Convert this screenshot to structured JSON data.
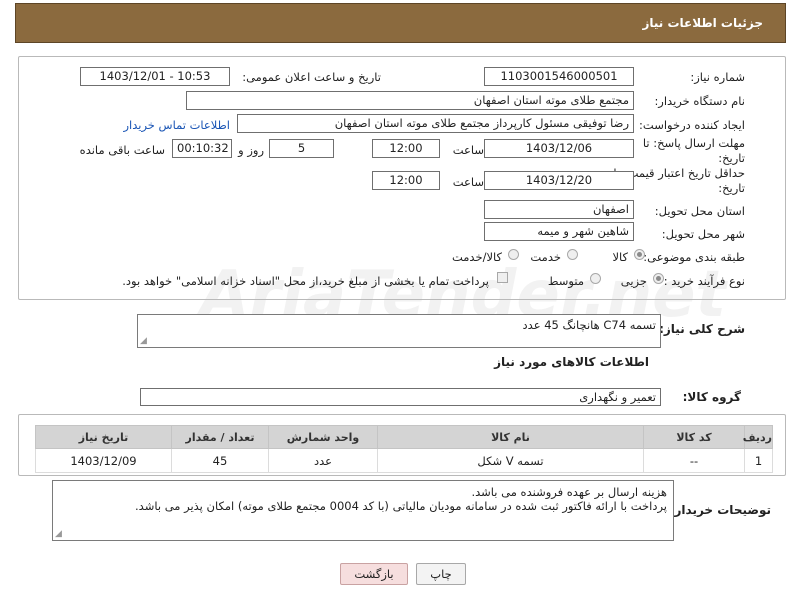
{
  "header": {
    "title": "جزئیات اطلاعات نیاز"
  },
  "watermark": {
    "text": "AriaTender.net"
  },
  "form": {
    "need_number_label": "شماره نیاز:",
    "need_number": "1103001546000501",
    "announce_label": "تاریخ و ساعت اعلان عمومی:",
    "announce_value": "1403/12/01 - 10:53",
    "buyer_org_label": "نام دستگاه خریدار:",
    "buyer_org": "مجتمع طلای موته استان اصفهان",
    "creator_label": "ایجاد کننده درخواست:",
    "creator": "رضا توفیقی مسئول کارپرداز مجتمع طلای موته استان اصفهان",
    "contact_link": "اطلاعات تماس خریدار",
    "reply_deadline_label_1": "مهلت ارسال پاسخ: تا",
    "reply_deadline_label_2": "تاریخ:",
    "reply_date": "1403/12/06",
    "time_label": "ساعت",
    "reply_time": "12:00",
    "days_value": "5",
    "days_label": "روز و",
    "remaining_value": "00:10:32",
    "remaining_label": "ساعت باقی مانده",
    "price_validity_label_1": "حداقل تاریخ اعتبار قیمت: تا",
    "price_validity_label_2": "تاریخ:",
    "price_date": "1403/12/20",
    "price_time": "12:00",
    "province_label": "استان محل تحویل:",
    "province": "اصفهان",
    "city_label": "شهر محل تحویل:",
    "city": "شاهین شهر و میمه",
    "category_label": "طبقه بندی موضوعی:",
    "category_options": [
      "کالا",
      "خدمت",
      "کالا/خدمت"
    ],
    "category_selected": "کالا",
    "process_label": "نوع فرآیند خرید :",
    "process_options": [
      "جزیی",
      "متوسط"
    ],
    "process_selected": "جزیی",
    "payment_note": "پرداخت تمام یا بخشی از مبلغ خرید،از محل \"اسناد خزانه اسلامی\" خواهد بود."
  },
  "summary": {
    "label": "شرح کلی نیاز:",
    "text": "تسمه C74 هانچانگ 45 عدد"
  },
  "goods": {
    "section_title": "اطلاعات کالاهای مورد نیاز",
    "group_label": "گروه کالا:",
    "group_value": "تعمیر و نگهداری",
    "columns": [
      "ردیف",
      "کد کالا",
      "نام کالا",
      "واحد شمارش",
      "تعداد / مقدار",
      "تاریخ نیاز"
    ],
    "rows": [
      [
        "1",
        "--",
        "تسمه V شکل",
        "عدد",
        "45",
        "1403/12/09"
      ]
    ]
  },
  "buyer_notes": {
    "label": "توضیحات خریدار:",
    "line1": "هزینه ارسال بر عهده فروشنده می باشد.",
    "line2": "پرداخت با ارائه فاکتور ثبت شده در سامانه مودیان مالیاتی (با کد 0004 مجتمع طلای موته) امکان پذیر می باشد."
  },
  "buttons": {
    "print": "چاپ",
    "back": "بازگشت"
  }
}
